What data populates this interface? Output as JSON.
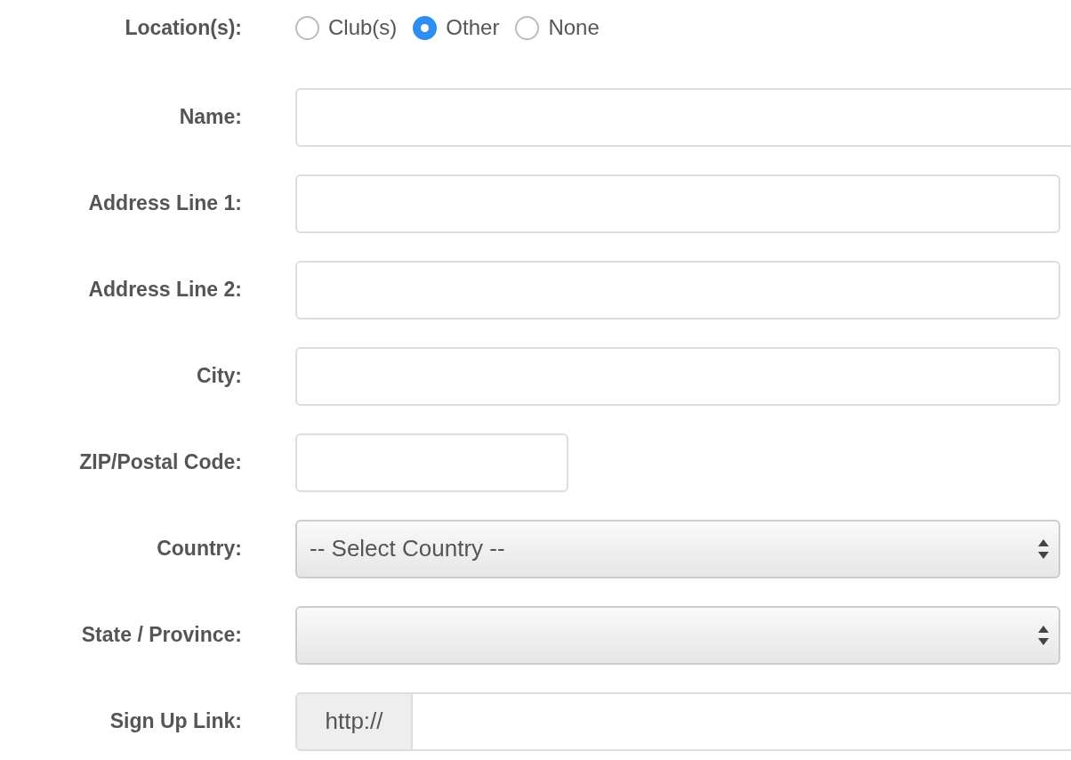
{
  "location": {
    "label": "Location(s):",
    "options": [
      {
        "label": "Club(s)",
        "selected": false
      },
      {
        "label": "Other",
        "selected": true
      },
      {
        "label": "None",
        "selected": false
      }
    ]
  },
  "fields": [
    {
      "kind": "text",
      "label": "Name:"
    },
    {
      "kind": "text",
      "label": "Address Line 1:"
    },
    {
      "kind": "text",
      "label": "Address Line 2:"
    },
    {
      "kind": "text",
      "label": "City:"
    },
    {
      "kind": "text",
      "label": "ZIP/Postal Code:"
    },
    {
      "kind": "select",
      "label": "Country:",
      "value": "-- Select Country --"
    },
    {
      "kind": "select",
      "label": "State / Province:"
    },
    {
      "kind": "url",
      "label": "Sign Up Link:",
      "prefix": "http://"
    }
  ]
}
